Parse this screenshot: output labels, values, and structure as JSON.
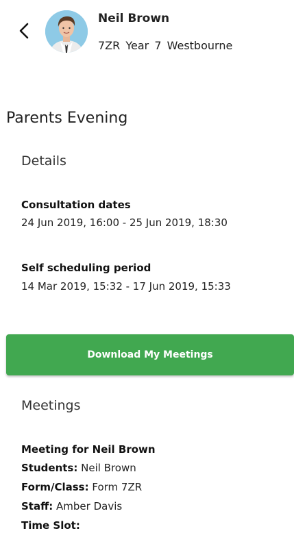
{
  "header": {
    "back_icon": "chevron-left-icon",
    "student_name": "Neil Brown",
    "form": "7ZR",
    "year": "Year 7",
    "house": "Westbourne"
  },
  "page_title": "Parents Evening",
  "details": {
    "heading": "Details",
    "consultation_label": "Consultation dates",
    "consultation_value": "24 Jun 2019, 16:00 - 25 Jun 2019, 18:30",
    "self_scheduling_label": "Self scheduling period",
    "self_scheduling_value": "14 Mar 2019, 15:32 - 17 Jun 2019, 15:33"
  },
  "download_button": {
    "label": "Download My Meetings",
    "color": "#41a850"
  },
  "meetings": {
    "heading": "Meetings",
    "title": "Meeting for Neil Brown",
    "students_label": "Students:",
    "students_value": "Neil Brown",
    "form_label": "Form/Class:",
    "form_value": "Form 7ZR",
    "staff_label": "Staff:",
    "staff_value": "Amber Davis",
    "timeslot_label": "Time Slot:",
    "timeslot_value": ""
  }
}
